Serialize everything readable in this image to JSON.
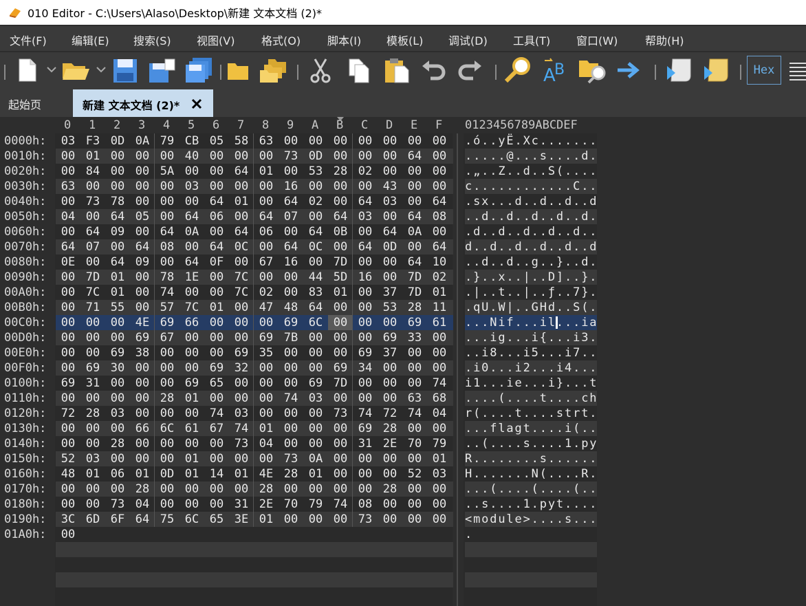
{
  "titlebar": {
    "title": "010 Editor - C:\\Users\\Alaso\\Desktop\\新建 文本文档 (2)*"
  },
  "menu": [
    "文件(F)",
    "编辑(E)",
    "搜索(S)",
    "视图(V)",
    "格式(O)",
    "脚本(I)",
    "模板(L)",
    "调试(D)",
    "工具(T)",
    "窗口(W)",
    "帮助(H)"
  ],
  "toolbar": {
    "hex_label": "Hex",
    "icons": [
      "new-file-icon",
      "open-folder-icon",
      "save-icon",
      "save-as-icon",
      "save-all-icon",
      "folder-icon",
      "folders-icon",
      "cut-icon",
      "copy-icon",
      "paste-icon",
      "undo-icon",
      "redo-icon",
      "find-icon",
      "replace-icon",
      "find-in-files-icon",
      "goto-icon",
      "run-script-icon",
      "run-template-icon",
      "list-icon"
    ]
  },
  "tabs": {
    "start_label": "起始页",
    "active_label": "新建 文本文档 (2)*",
    "close_glyph": "✕"
  },
  "editor": {
    "hex_columns": [
      "0",
      "1",
      "2",
      "3",
      "4",
      "5",
      "6",
      "7",
      "8",
      "9",
      "A",
      "B",
      "C",
      "D",
      "E",
      "F"
    ],
    "ascii_header": "0123456789ABCDEF",
    "rows": [
      {
        "addr": "0000h:",
        "bytes": [
          "03",
          "F3",
          "0D",
          "0A",
          "79",
          "CB",
          "05",
          "58",
          "63",
          "00",
          "00",
          "00",
          "00",
          "00",
          "00",
          "00"
        ],
        "ascii": ".ó..yË.Xc......."
      },
      {
        "addr": "0010h:",
        "bytes": [
          "00",
          "01",
          "00",
          "00",
          "00",
          "40",
          "00",
          "00",
          "00",
          "73",
          "0D",
          "00",
          "00",
          "00",
          "64",
          "00"
        ],
        "ascii": ".....@...s....d."
      },
      {
        "addr": "0020h:",
        "bytes": [
          "00",
          "84",
          "00",
          "00",
          "5A",
          "00",
          "00",
          "64",
          "01",
          "00",
          "53",
          "28",
          "02",
          "00",
          "00",
          "00"
        ],
        "ascii": ".„..Z..d..S(...."
      },
      {
        "addr": "0030h:",
        "bytes": [
          "63",
          "00",
          "00",
          "00",
          "00",
          "03",
          "00",
          "00",
          "00",
          "16",
          "00",
          "00",
          "00",
          "43",
          "00",
          "00"
        ],
        "ascii": "c............C.."
      },
      {
        "addr": "0040h:",
        "bytes": [
          "00",
          "73",
          "78",
          "00",
          "00",
          "00",
          "64",
          "01",
          "00",
          "64",
          "02",
          "00",
          "64",
          "03",
          "00",
          "64"
        ],
        "ascii": ".sx...d..d..d..d"
      },
      {
        "addr": "0050h:",
        "bytes": [
          "04",
          "00",
          "64",
          "05",
          "00",
          "64",
          "06",
          "00",
          "64",
          "07",
          "00",
          "64",
          "03",
          "00",
          "64",
          "08"
        ],
        "ascii": "..d..d..d..d..d."
      },
      {
        "addr": "0060h:",
        "bytes": [
          "00",
          "64",
          "09",
          "00",
          "64",
          "0A",
          "00",
          "64",
          "06",
          "00",
          "64",
          "0B",
          "00",
          "64",
          "0A",
          "00"
        ],
        "ascii": ".d..d..d..d..d.."
      },
      {
        "addr": "0070h:",
        "bytes": [
          "64",
          "07",
          "00",
          "64",
          "08",
          "00",
          "64",
          "0C",
          "00",
          "64",
          "0C",
          "00",
          "64",
          "0D",
          "00",
          "64"
        ],
        "ascii": "d..d..d..d..d..d"
      },
      {
        "addr": "0080h:",
        "bytes": [
          "0E",
          "00",
          "64",
          "09",
          "00",
          "64",
          "0F",
          "00",
          "67",
          "16",
          "00",
          "7D",
          "00",
          "00",
          "64",
          "10"
        ],
        "ascii": "..d..d..g..}..d."
      },
      {
        "addr": "0090h:",
        "bytes": [
          "00",
          "7D",
          "01",
          "00",
          "78",
          "1E",
          "00",
          "7C",
          "00",
          "00",
          "44",
          "5D",
          "16",
          "00",
          "7D",
          "02"
        ],
        "ascii": ".}..x..|..D]..}."
      },
      {
        "addr": "00A0h:",
        "bytes": [
          "00",
          "7C",
          "01",
          "00",
          "74",
          "00",
          "00",
          "7C",
          "02",
          "00",
          "83",
          "01",
          "00",
          "37",
          "7D",
          "01"
        ],
        "ascii": ".|..t..|..ƒ..7}."
      },
      {
        "addr": "00B0h:",
        "bytes": [
          "00",
          "71",
          "55",
          "00",
          "57",
          "7C",
          "01",
          "00",
          "47",
          "48",
          "64",
          "00",
          "00",
          "53",
          "28",
          "11"
        ],
        "ascii": ".qU.W|..GHd..S(."
      },
      {
        "addr": "00C0h:",
        "bytes": [
          "00",
          "00",
          "00",
          "4E",
          "69",
          "66",
          "00",
          "00",
          "00",
          "69",
          "6C",
          "00",
          "00",
          "00",
          "69",
          "61"
        ],
        "ascii": "...Nif...il...ia"
      },
      {
        "addr": "00D0h:",
        "bytes": [
          "00",
          "00",
          "00",
          "69",
          "67",
          "00",
          "00",
          "00",
          "69",
          "7B",
          "00",
          "00",
          "00",
          "69",
          "33",
          "00"
        ],
        "ascii": "...ig...i{...i3."
      },
      {
        "addr": "00E0h:",
        "bytes": [
          "00",
          "00",
          "69",
          "38",
          "00",
          "00",
          "00",
          "69",
          "35",
          "00",
          "00",
          "00",
          "69",
          "37",
          "00",
          "00"
        ],
        "ascii": "..i8...i5...i7.."
      },
      {
        "addr": "00F0h:",
        "bytes": [
          "00",
          "69",
          "30",
          "00",
          "00",
          "00",
          "69",
          "32",
          "00",
          "00",
          "00",
          "69",
          "34",
          "00",
          "00",
          "00"
        ],
        "ascii": ".i0...i2...i4..."
      },
      {
        "addr": "0100h:",
        "bytes": [
          "69",
          "31",
          "00",
          "00",
          "00",
          "69",
          "65",
          "00",
          "00",
          "00",
          "69",
          "7D",
          "00",
          "00",
          "00",
          "74"
        ],
        "ascii": "i1...ie...i}...t"
      },
      {
        "addr": "0110h:",
        "bytes": [
          "00",
          "00",
          "00",
          "00",
          "28",
          "01",
          "00",
          "00",
          "00",
          "74",
          "03",
          "00",
          "00",
          "00",
          "63",
          "68"
        ],
        "ascii": "....(....t....ch"
      },
      {
        "addr": "0120h:",
        "bytes": [
          "72",
          "28",
          "03",
          "00",
          "00",
          "00",
          "74",
          "03",
          "00",
          "00",
          "00",
          "73",
          "74",
          "72",
          "74",
          "04"
        ],
        "ascii": "r(....t....strt."
      },
      {
        "addr": "0130h:",
        "bytes": [
          "00",
          "00",
          "00",
          "66",
          "6C",
          "61",
          "67",
          "74",
          "01",
          "00",
          "00",
          "00",
          "69",
          "28",
          "00",
          "00"
        ],
        "ascii": "...flagt....i(.."
      },
      {
        "addr": "0140h:",
        "bytes": [
          "00",
          "00",
          "28",
          "00",
          "00",
          "00",
          "00",
          "73",
          "04",
          "00",
          "00",
          "00",
          "31",
          "2E",
          "70",
          "79"
        ],
        "ascii": "..(....s....1.py"
      },
      {
        "addr": "0150h:",
        "bytes": [
          "52",
          "03",
          "00",
          "00",
          "00",
          "01",
          "00",
          "00",
          "00",
          "73",
          "0A",
          "00",
          "00",
          "00",
          "00",
          "01"
        ],
        "ascii": "R........s......"
      },
      {
        "addr": "0160h:",
        "bytes": [
          "48",
          "01",
          "06",
          "01",
          "0D",
          "01",
          "14",
          "01",
          "4E",
          "28",
          "01",
          "00",
          "00",
          "00",
          "52",
          "03"
        ],
        "ascii": "H.......N(....R."
      },
      {
        "addr": "0170h:",
        "bytes": [
          "00",
          "00",
          "00",
          "28",
          "00",
          "00",
          "00",
          "00",
          "28",
          "00",
          "00",
          "00",
          "00",
          "28",
          "00",
          "00"
        ],
        "ascii": "...(....(....(.."
      },
      {
        "addr": "0180h:",
        "bytes": [
          "00",
          "00",
          "73",
          "04",
          "00",
          "00",
          "00",
          "31",
          "2E",
          "70",
          "79",
          "74",
          "08",
          "00",
          "00",
          "00"
        ],
        "ascii": "..s....1.pyt...."
      },
      {
        "addr": "0190h:",
        "bytes": [
          "3C",
          "6D",
          "6F",
          "64",
          "75",
          "6C",
          "65",
          "3E",
          "01",
          "00",
          "00",
          "00",
          "73",
          "00",
          "00",
          "00"
        ],
        "ascii": "<module>....s..."
      },
      {
        "addr": "01A0h:",
        "bytes": [
          "00"
        ],
        "ascii": "."
      }
    ],
    "selected_row_index": 12,
    "cursor_byte_column": 11,
    "colors": {
      "selection": "#253c64",
      "stripe": "#3a3a3a",
      "background": "#2a2a2a",
      "text": "#e8e8e8",
      "hex_button": "#6ab0e8"
    }
  }
}
